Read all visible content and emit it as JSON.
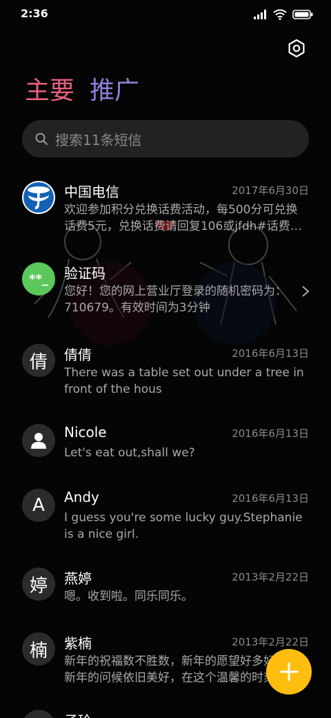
{
  "status_bar": {
    "time": "2:36"
  },
  "tabs": [
    {
      "label": "主要",
      "color": "#e8607a"
    },
    {
      "label": "推广",
      "color": "#8d80d8"
    }
  ],
  "search": {
    "placeholder": "搜索11条短信"
  },
  "accent_color": "#ffbe0f",
  "conversations": [
    {
      "name": "中国电信",
      "date": "2017年6月30日",
      "preview": "欢迎参加积分兑换话费活动，每500分可兑换\n话费5元，兑换话费请回复106或jfdh#话费…",
      "avatar_icon": "china-telecom-logo-icon"
    },
    {
      "name": "验证码",
      "date": "",
      "preview": "您好！您的网上营业厅登录的随机密码为：\n710679。有效时间为3分钟",
      "avatar_text": "**_",
      "avatar_color": "#5cc85c"
    },
    {
      "name": "倩倩",
      "date": "2016年6月13日",
      "preview": "There was a table set out under a tree in\nfront of the hous",
      "avatar_text": "倩"
    },
    {
      "name": "Nicole",
      "date": "2016年6月13日",
      "preview": "Let's eat out,shall we?",
      "avatar_icon": "person-icon"
    },
    {
      "name": "Andy",
      "date": "2016年6月13日",
      "preview": "I guess you're some lucky guy.Stephanie\nis a nice girl.",
      "avatar_text": "A"
    },
    {
      "name": "燕婷",
      "date": "2013年2月22日",
      "preview": "嗯。收到啦。同乐同乐。",
      "avatar_text": "婷"
    },
    {
      "name": "紫楠",
      "date": "2013年2月22日",
      "preview": "新年的祝福数不胜数，新年的愿望好多好多，\n新年的问候依旧美好，在这个温馨的时刻…",
      "avatar_text": "楠"
    },
    {
      "name": "子玲",
      "date": "",
      "preview": "",
      "avatar_text": ""
    }
  ]
}
